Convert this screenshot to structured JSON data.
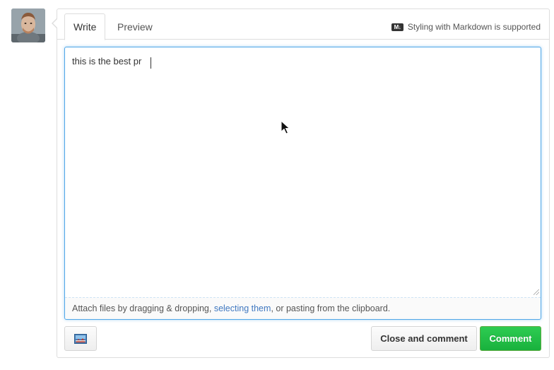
{
  "tabs": {
    "write_label": "Write",
    "preview_label": "Preview"
  },
  "markdown_hint": {
    "icon": "M↓",
    "text": "Styling with Markdown is supported"
  },
  "editor": {
    "value": "this is the best pr"
  },
  "attach": {
    "prefix": "Attach files by dragging & dropping, ",
    "link": "selecting them",
    "suffix": ", or pasting from the clipboard."
  },
  "buttons": {
    "close_and_comment": "Close and comment",
    "comment": "Comment"
  },
  "colors": {
    "focus": "#51a7e8",
    "comment_button": "#2cbe4e",
    "link": "#4078c0"
  }
}
